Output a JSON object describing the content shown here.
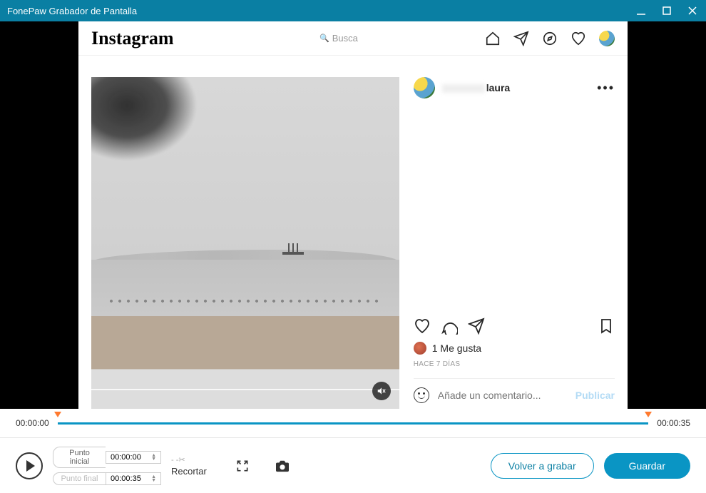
{
  "titlebar": {
    "title": "FonePaw Grabador de Pantalla"
  },
  "instagram": {
    "logo": "Instagram",
    "search_placeholder": "Busca",
    "username_suffix": "laura",
    "likes": "1 Me gusta",
    "time_ago": "HACE 7 DÍAS",
    "comment_placeholder": "Añade un comentario...",
    "publish": "Publicar"
  },
  "timeline": {
    "start": "00:00:00",
    "end": "00:00:35"
  },
  "trim": {
    "start_label": "Punto inicial",
    "end_label": "Punto final",
    "start_time": "00:00:00",
    "end_time": "00:00:35",
    "cut_label": "Recortar"
  },
  "buttons": {
    "rerecord": "Volver a grabar",
    "save": "Guardar"
  }
}
